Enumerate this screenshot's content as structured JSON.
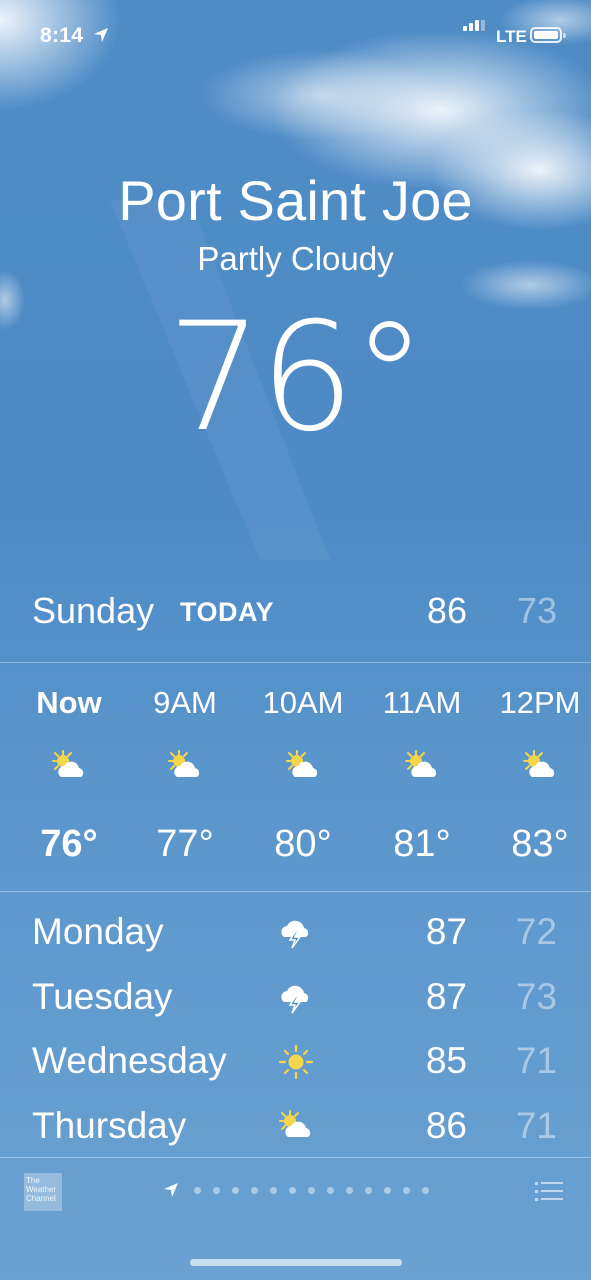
{
  "status_bar": {
    "time": "8:14",
    "network": "LTE"
  },
  "location": {
    "city": "Port Saint Joe",
    "condition": "Partly Cloudy",
    "temperature": "76°"
  },
  "today": {
    "day": "Sunday",
    "badge": "TODAY",
    "high": "86",
    "low": "73"
  },
  "hourly": [
    {
      "label": "Now",
      "icon": "partly-cloudy-icon",
      "temp": "76°"
    },
    {
      "label": "9AM",
      "icon": "partly-cloudy-icon",
      "temp": "77°"
    },
    {
      "label": "10AM",
      "icon": "partly-cloudy-icon",
      "temp": "80°"
    },
    {
      "label": "11AM",
      "icon": "partly-cloudy-icon",
      "temp": "81°"
    },
    {
      "label": "12PM",
      "icon": "partly-cloudy-icon",
      "temp": "83°"
    }
  ],
  "daily": [
    {
      "day": "Monday",
      "icon": "thunderstorm-icon",
      "high": "87",
      "low": "72"
    },
    {
      "day": "Tuesday",
      "icon": "thunderstorm-icon",
      "high": "87",
      "low": "73"
    },
    {
      "day": "Wednesday",
      "icon": "sunny-icon",
      "high": "85",
      "low": "71"
    },
    {
      "day": "Thursday",
      "icon": "partly-cloudy-icon",
      "high": "86",
      "low": "71"
    }
  ],
  "footer": {
    "provider_logo": "The Weather Channel",
    "page_dots": 13
  },
  "colors": {
    "sky": "#4f8cc6",
    "sun": "#f5d54a",
    "cloud": "#ffffff"
  }
}
